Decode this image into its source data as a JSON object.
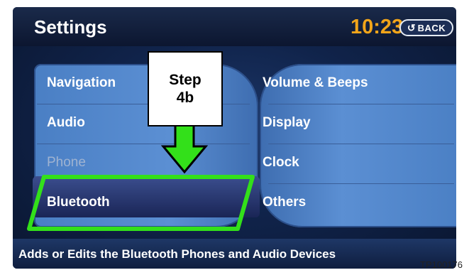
{
  "header": {
    "title": "Settings",
    "time": "10:23",
    "back_label": "BACK",
    "back_icon": "back-arrow-icon"
  },
  "menu": {
    "left": [
      {
        "label": "Navigation",
        "enabled": true
      },
      {
        "label": "Audio",
        "enabled": true
      },
      {
        "label": "Phone",
        "enabled": false
      },
      {
        "label": "Bluetooth",
        "enabled": true,
        "selected": true
      }
    ],
    "right": [
      {
        "label": "Volume & Beeps",
        "enabled": true
      },
      {
        "label": "Display",
        "enabled": true
      },
      {
        "label": "Clock",
        "enabled": true
      },
      {
        "label": "Others",
        "enabled": true
      }
    ]
  },
  "status_bar": {
    "text": "Adds or Edits the Bluetooth Phones and Audio Devices"
  },
  "annotation": {
    "step_line1": "Step",
    "step_line2": "4b",
    "highlight_color": "#33e01a",
    "arrow_icon": "down-arrow-icon"
  },
  "figure_code": "TP100176",
  "colors": {
    "time": "#f2a51a",
    "menu_blue": "#5b8fd3",
    "disabled_text": "#9fb3d1"
  }
}
